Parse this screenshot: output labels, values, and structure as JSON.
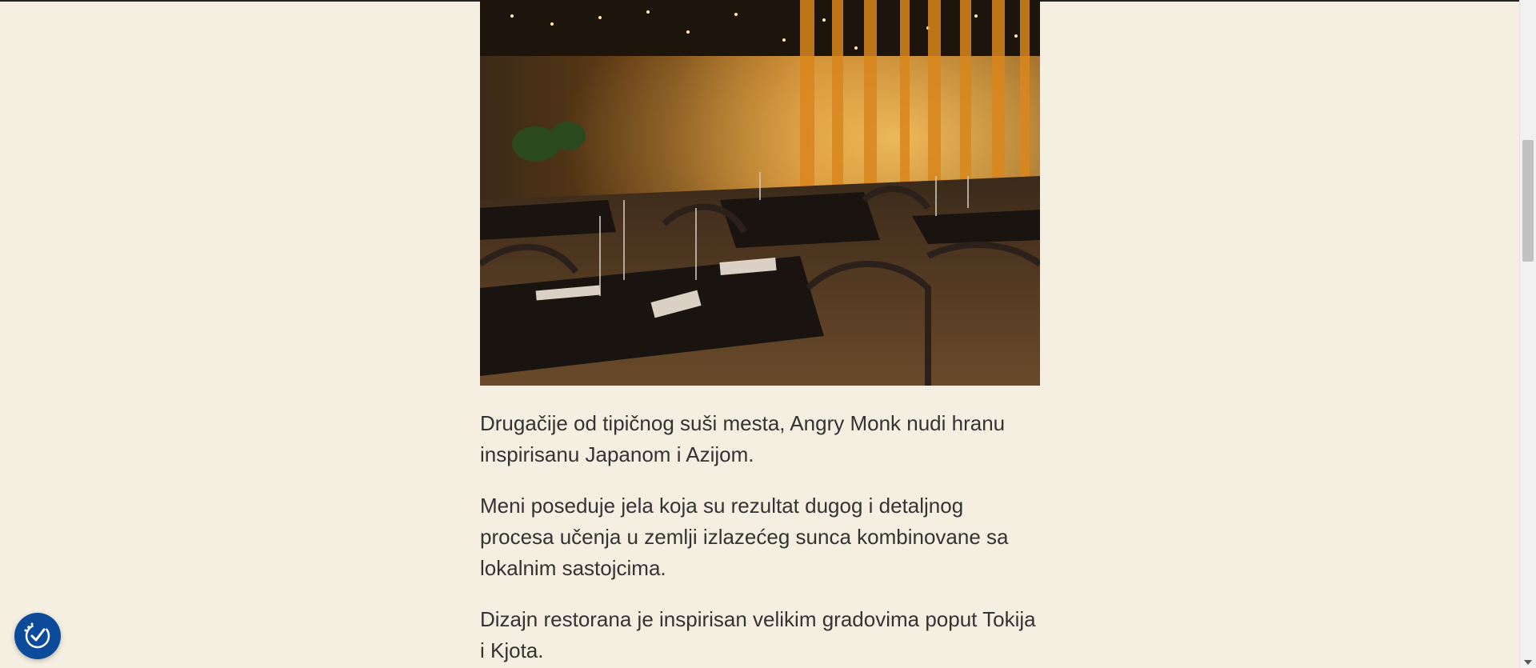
{
  "article": {
    "hero_image_alt": "Enterijer restorana Angry Monk",
    "paragraphs": [
      "Drugačije od tipičnog suši mesta, Angry Monk nudi hranu inspirisanu Japanom i Azijom.",
      "Meni poseduje jela koja su rezultat dugog i detaljnog procesa učenja u zemlji izlazećeg sunca kombinovane sa lokalnim sastojcima.",
      "Dizajn restorana je inspirisan velikim gradovima poput Tokija i Kjota."
    ]
  },
  "accessibility": {
    "icon": "accessibility-checkmark-icon",
    "color": "#0b4b9a"
  },
  "theme": {
    "background": "#f5efe1",
    "text": "#333333"
  }
}
